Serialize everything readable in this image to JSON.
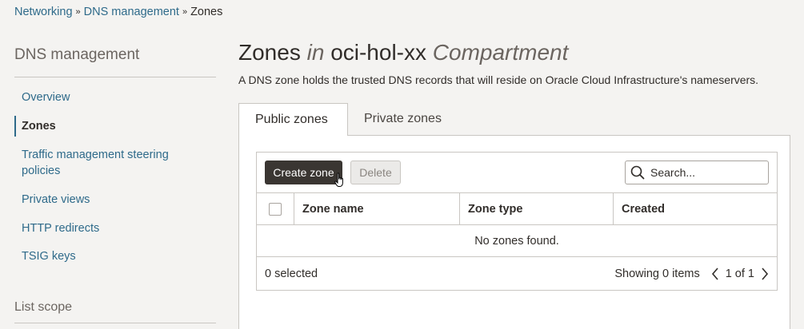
{
  "breadcrumb": {
    "items": [
      "Networking",
      "DNS management"
    ],
    "separator": "»",
    "current": "Zones"
  },
  "sidebar": {
    "title": "DNS management",
    "items": [
      {
        "label": "Overview"
      },
      {
        "label": "Zones",
        "active": true
      },
      {
        "label": "Traffic management steering policies"
      },
      {
        "label": "Private views"
      },
      {
        "label": "HTTP redirects"
      },
      {
        "label": "TSIG keys"
      }
    ],
    "list_scope_title": "List scope"
  },
  "page": {
    "title_main": "Zones",
    "title_in": "in",
    "compartment": "oci-hol-xx",
    "compartment_label": "Compartment",
    "description": "A DNS zone holds the trusted DNS records that will reside on Oracle Cloud Infrastructure's nameservers."
  },
  "tabs": [
    {
      "label": "Public zones",
      "active": true
    },
    {
      "label": "Private zones",
      "active": false
    }
  ],
  "toolbar": {
    "create_label": "Create zone",
    "delete_label": "Delete",
    "search_placeholder": "Search..."
  },
  "table": {
    "columns": [
      "Zone name",
      "Zone type",
      "Created"
    ],
    "empty_message": "No zones found.",
    "selected_text": "0 selected",
    "showing_text": "Showing 0 items",
    "page_text": "1 of 1"
  },
  "colors": {
    "link": "#2e6a8a",
    "primary_button": "#3a3632",
    "background": "#f4f3f1"
  }
}
